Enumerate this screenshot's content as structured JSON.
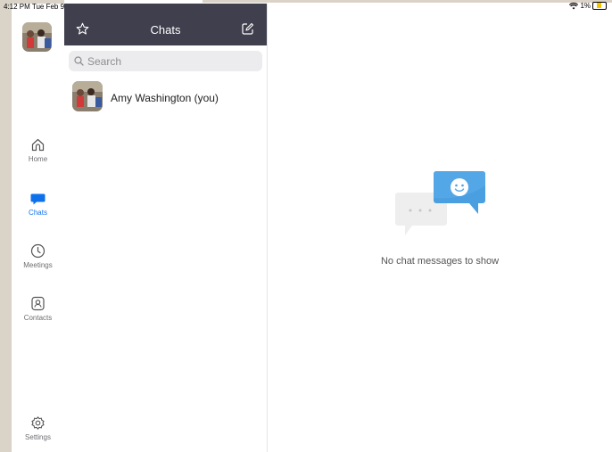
{
  "status_bar": {
    "time": "4:12 PM  Tue Feb 9",
    "battery": "1%"
  },
  "rail": {
    "items": [
      {
        "label": "Home",
        "icon": "home-icon"
      },
      {
        "label": "Chats",
        "icon": "chat-bubble-icon",
        "active": true
      },
      {
        "label": "Meetings",
        "icon": "clock-icon"
      },
      {
        "label": "Contacts",
        "icon": "contact-icon"
      },
      {
        "label": "Settings",
        "icon": "gear-icon"
      }
    ]
  },
  "chats_panel": {
    "title": "Chats",
    "search_placeholder": "Search",
    "conversations": [
      {
        "name": "Amy Washington (you)"
      }
    ]
  },
  "empty_state": {
    "message": "No chat messages to show"
  },
  "colors": {
    "accent": "#0e71eb",
    "header_bg": "#3f3f4d",
    "bubble_blue": "#4a9fe0",
    "bubble_grey": "#eeeeee"
  }
}
